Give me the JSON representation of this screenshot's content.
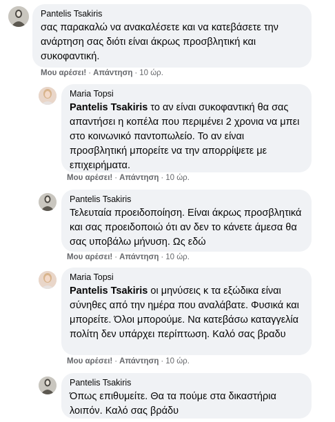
{
  "actions": {
    "like": "Μου αρέσει!",
    "reply": "Απάντηση",
    "separator": "·"
  },
  "comments": [
    {
      "author": "Pantelis Tsakiris",
      "mention": "",
      "text": "σας παρακαλώ να ανακαλέσετε και να κατεβάσετε την ανάρτηση σας διότι είναι άκρως προσβλητική και συκοφαντική.",
      "time": "10 ώρ."
    },
    {
      "author": "Maria Topsi",
      "mention": "Pantelis Tsakiris",
      "text": "το αν είναι συκοφαντική θα σας απαντήσει η κοπέλα που περιμένει 2 χρονια να μπει στο κοινωνικό παντοπωλείο. Το αν είναι προσβλητική μπορείτε να την απορρίψετε με επιχειρήματα.",
      "time": "10 ώρ."
    },
    {
      "author": "Pantelis Tsakiris",
      "mention": "",
      "text": "Τελευταία προειδοποίηση. Είναι άκρως προσβλητικά και σας προειδοποιώ ότι αν δεν το κάνετε άμεσα θα σας υποβάλω μήνυση. Ως εδώ",
      "time": "10 ώρ."
    },
    {
      "author": "Maria Topsi",
      "mention": "Pantelis Tsakiris",
      "text": "οι μηνύσεις κ τα εξώδικα είναι σύνηθες από την ημέρα που αναλάβατε. Φυσικά και μπορείτε. Όλοι μπορούμε. Να κατεβάσω καταγγελία πολίτη δεν υπάρχει περίπτωση. Καλό σας βραδυ",
      "time": "10 ώρ."
    },
    {
      "author": "Pantelis Tsakiris",
      "mention": "",
      "text": "Όπως επιθυμείτε. Θα τα πούμε στα δικαστήρια λοιπόν. Καλό σας βράδυ",
      "time": ""
    }
  ]
}
